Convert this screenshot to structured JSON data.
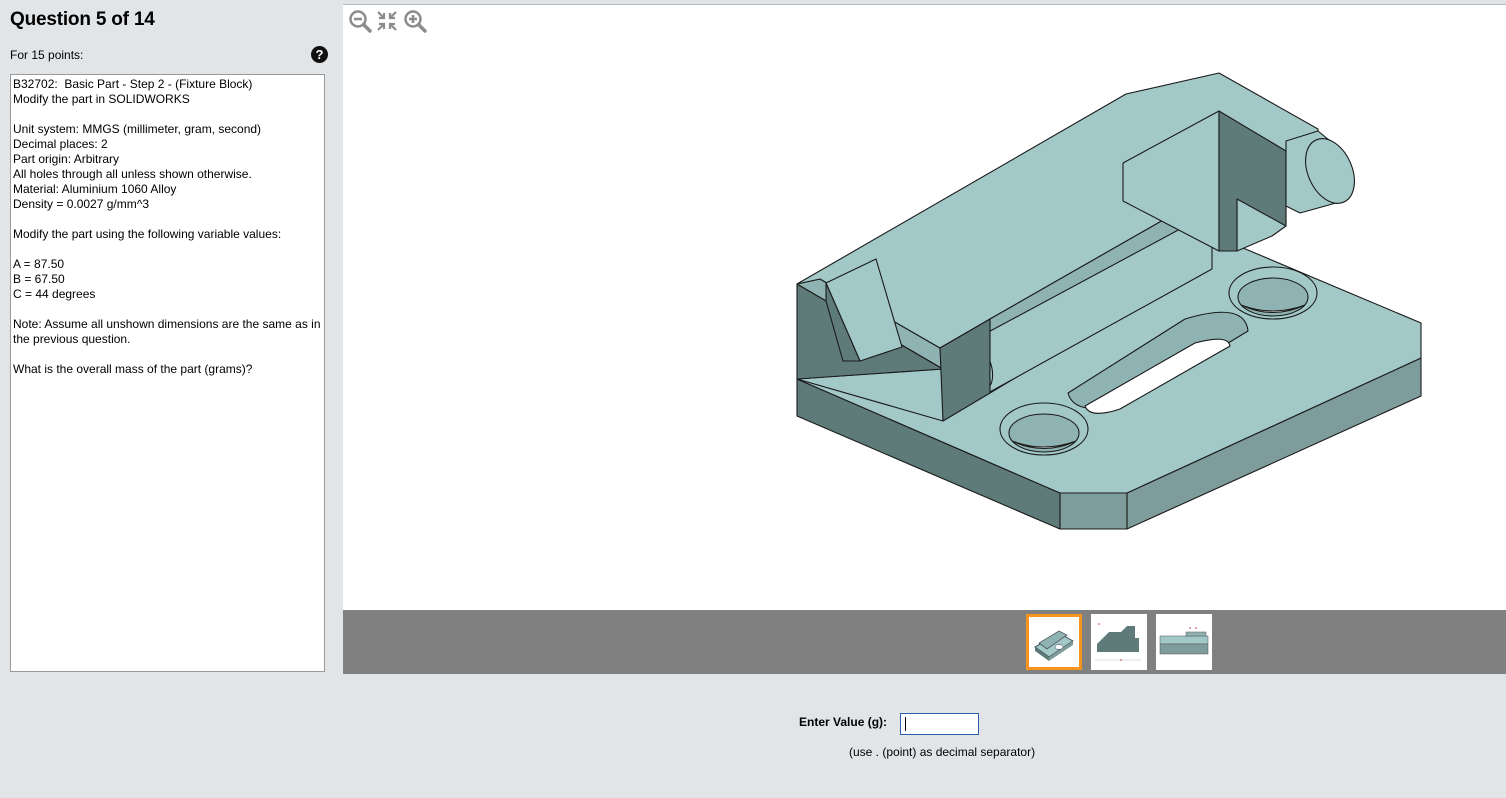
{
  "header": {
    "question_title": "Question 5 of 14",
    "points_label": "For 15 points:",
    "help_icon": "question-circle-icon"
  },
  "question": {
    "lines": [
      "B32702:  Basic Part - Step 2 - (Fixture Block)",
      "Modify the part in SOLIDWORKS",
      "",
      "Unit system: MMGS (millimeter, gram, second)",
      "Decimal places: 2",
      "Part origin: Arbitrary",
      "All holes through all unless shown otherwise.",
      "Material: Aluminium 1060 Alloy",
      "Density = 0.0027 g/mm^3",
      "",
      "Modify the part using the following variable values:",
      "",
      "A = 87.50",
      "B = 67.50",
      "C = 44 degrees",
      "",
      "Note: Assume all unshown dimensions are the same as in",
      "the previous question.",
      "",
      "What is the overall mass of the part (grams)?"
    ]
  },
  "viewer": {
    "tools": [
      "zoom-out-icon",
      "fit-to-view-icon",
      "zoom-in-icon"
    ],
    "model_color": "#a2c8c8",
    "model_dark_color": "#5e7a79",
    "thumbnails": [
      {
        "name": "isometric-view",
        "selected": true
      },
      {
        "name": "side-view",
        "selected": false
      },
      {
        "name": "front-view",
        "selected": false
      }
    ],
    "selected_border_color": "#f7941d"
  },
  "answer": {
    "label": "Enter Value (g):",
    "value": "",
    "hint": "(use . (point) as decimal separator)"
  }
}
